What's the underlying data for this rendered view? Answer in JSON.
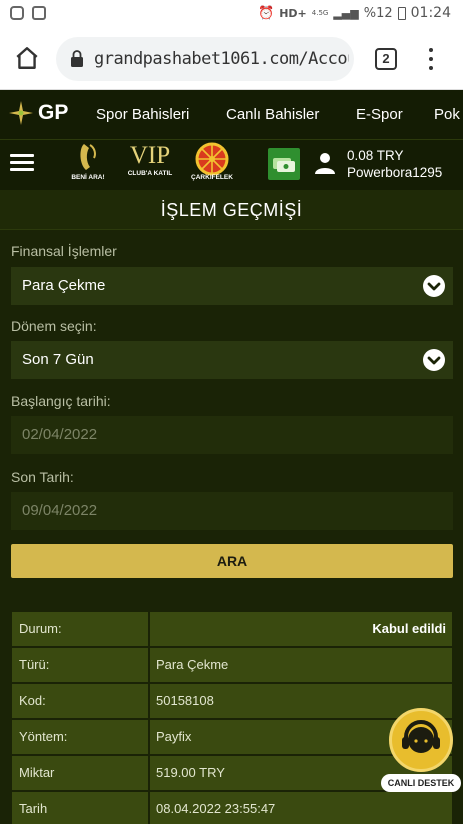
{
  "status_bar": {
    "network": "HD+",
    "network_type": "4.5G",
    "battery": "%12",
    "time": "01:24"
  },
  "browser": {
    "url": "grandpashabet1061.com/Account",
    "tab_count": "2"
  },
  "site_nav": {
    "logo": "GP",
    "items": [
      "Spor Bahisleri",
      "Canlı Bahisler",
      "E-Spor",
      "Pok"
    ]
  },
  "account_bar": {
    "promos": [
      "BENİ ARA!",
      "CLUB'A KATIL",
      "ÇARKIFELEK"
    ],
    "vip_label": "VIP",
    "balance": "0.08 TRY",
    "username": "Powerbora1295"
  },
  "page": {
    "title": "İŞLEM GEÇMİŞİ"
  },
  "form": {
    "financial_label": "Finansal İşlemler",
    "financial_value": "Para Çekme",
    "period_label": "Dönem seçin:",
    "period_value": "Son 7 Gün",
    "start_label": "Başlangıç tarihi:",
    "start_value": "02/04/2022",
    "end_label": "Son Tarih:",
    "end_value": "09/04/2022",
    "search_button": "ARA"
  },
  "result": {
    "rows": [
      {
        "key": "Durum:",
        "value": "Kabul edildi"
      },
      {
        "key": "Türü:",
        "value": "Para Çekme"
      },
      {
        "key": "Kod:",
        "value": "50158108"
      },
      {
        "key": "Yöntem:",
        "value": "Payfix"
      },
      {
        "key": "Miktar",
        "value": "519.00 TRY"
      },
      {
        "key": "Tarih",
        "value": "08.04.2022 23:55:47"
      }
    ]
  },
  "support": {
    "label": "CANLI DESTEK"
  }
}
